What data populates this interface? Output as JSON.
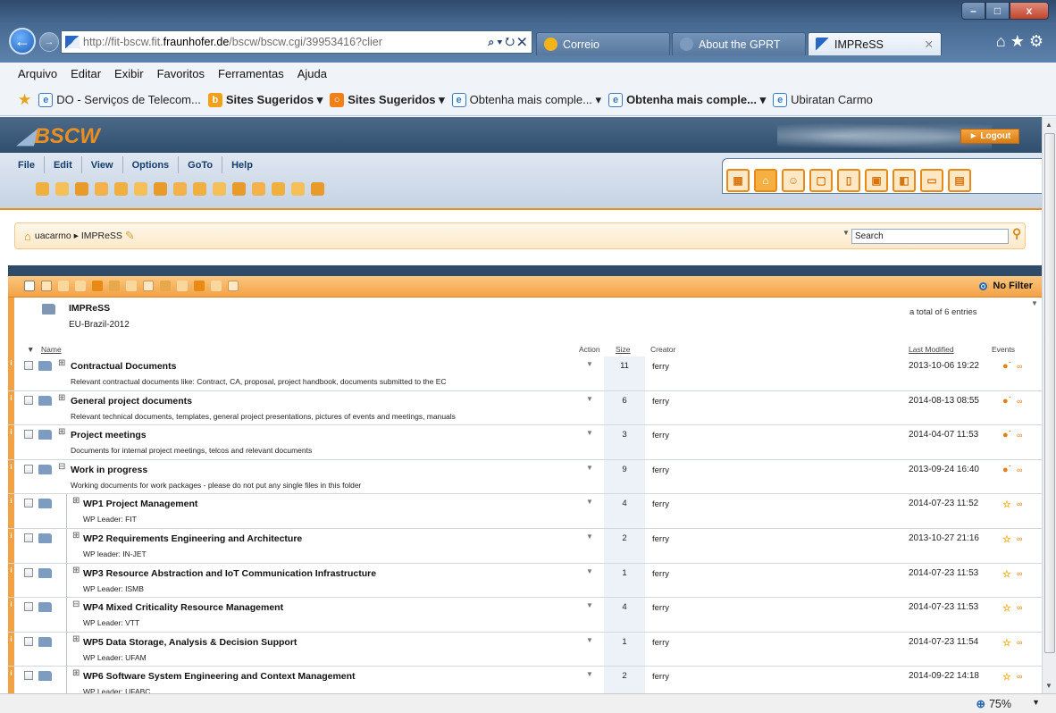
{
  "browser": {
    "url_prefix": "http://fit-bscw.fit.",
    "url_domain": "fraunhofer.de",
    "url_suffix": "/bscw/bscw.cgi/39953416?clier",
    "addr_controls": "⌕ ▾ ↻ ✕",
    "tabs": [
      {
        "label": "Correio"
      },
      {
        "label": "About the GPRT"
      },
      {
        "label": "IMPReSS",
        "close": "✕"
      }
    ],
    "toolbar_icons": "⌂ ★ ⚙",
    "window_buttons": {
      "minimize": "–",
      "maximize": "□",
      "close": "x"
    },
    "menu": [
      "Arquivo",
      "Editar",
      "Exibir",
      "Favoritos",
      "Ferramentas",
      "Ajuda"
    ],
    "favorites": [
      {
        "label": "DO - Serviços de Telecom...",
        "bold": false
      },
      {
        "label": "Sites Sugeridos ▾",
        "bold": true
      },
      {
        "label": "Sites Sugeridos ▾",
        "bold": true
      },
      {
        "label": "Obtenha mais comple... ▾",
        "bold": false
      },
      {
        "label": "Obtenha mais comple... ▾",
        "bold": true
      },
      {
        "label": "Ubiratan Carmo",
        "bold": false
      }
    ],
    "zoom": "75%"
  },
  "bscw": {
    "logo": "BSCW",
    "logout": "Logout",
    "menu": [
      "File",
      "Edit",
      "View",
      "Options",
      "GoTo",
      "Help"
    ],
    "breadcrumb": "uacarmo ▸ IMPReSS",
    "search_placeholder": "Search",
    "filter": "No Filter",
    "folder_title": "IMPReSS",
    "folder_subtitle": "EU-Brazil-2012",
    "total": "a total of 6 entries",
    "columns": {
      "name": "Name",
      "action": "Action",
      "size": "Size",
      "creator": "Creator",
      "last_modified": "Last Modified",
      "events": "Events"
    },
    "rows": [
      {
        "expander": "⊞",
        "title": "Contractual Documents",
        "desc": "Relevant contractual documents like: Contract, CA, proposal, project handbook, documents submitted to the EC",
        "size": "11",
        "creator": "ferry",
        "modified": "2013-10-06 19:22",
        "event": "new"
      },
      {
        "expander": "⊞",
        "title": "General project documents",
        "desc": "Relevant technical documents, templates, general project presentations, pictures of events and meetings, manuals",
        "size": "6",
        "creator": "ferry",
        "modified": "2014-08-13 08:55",
        "event": "new"
      },
      {
        "expander": "⊞",
        "title": "Project meetings",
        "desc": "Documents for internal project meetings, telcos and relevant documents",
        "size": "3",
        "creator": "ferry",
        "modified": "2014-04-07 11:53",
        "event": "new"
      },
      {
        "expander": "⊟",
        "title": "Work in progress",
        "desc": "Working documents for work packages - please do not put any single files in this folder",
        "size": "9",
        "creator": "ferry",
        "modified": "2013-09-24 16:40",
        "event": "new"
      },
      {
        "expander": "⊞",
        "title": "WP1 Project Management",
        "desc": "WP Leader: FIT",
        "size": "4",
        "creator": "ferry",
        "modified": "2014-07-23 11:52",
        "event": "star"
      },
      {
        "expander": "⊞",
        "title": "WP2 Requirements Engineering and Architecture",
        "desc": "WP leader: IN-JET",
        "size": "2",
        "creator": "ferry",
        "modified": "2013-10-27 21:16",
        "event": "star"
      },
      {
        "expander": "⊞",
        "title": "WP3 Resource Abstraction and IoT Communication Infrastructure",
        "desc": "WP Leader: ISMB",
        "size": "1",
        "creator": "ferry",
        "modified": "2014-07-23 11:53",
        "event": "star"
      },
      {
        "expander": "⊟",
        "title": "WP4 Mixed Criticality Resource Management",
        "desc": "WP Leader: VTT",
        "size": "4",
        "creator": "ferry",
        "modified": "2014-07-23 11:53",
        "event": "star"
      },
      {
        "expander": "⊞",
        "title": "WP5 Data Storage, Analysis & Decision Support",
        "desc": "WP Leader: UFAM",
        "size": "1",
        "creator": "ferry",
        "modified": "2014-07-23 11:54",
        "event": "star"
      },
      {
        "expander": "⊞",
        "title": "WP6 Software System Engineering and Context Management",
        "desc": "WP Leader: UFABC",
        "size": "2",
        "creator": "ferry",
        "modified": "2014-09-22 14:18",
        "event": "star"
      }
    ]
  }
}
